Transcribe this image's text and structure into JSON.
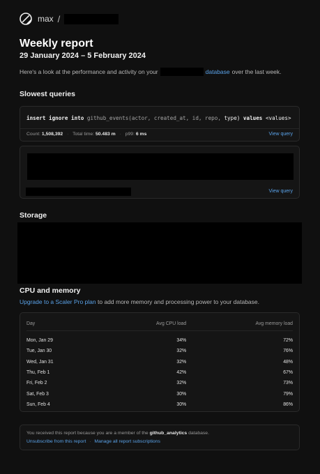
{
  "header": {
    "user": "max",
    "separator": "/"
  },
  "report": {
    "title": "Weekly report",
    "date_range": "29 January 2024 – 5 February 2024",
    "intro_before": "Here's a look at the performance and activity on your",
    "intro_link": "database",
    "intro_after": "over the last week."
  },
  "slowest_queries": {
    "heading": "Slowest queries",
    "query1": {
      "code_kw1": "insert ignore into",
      "code_table": "github_events(actor, created_at, id, repo,",
      "code_kw2": "type)",
      "code_kw3": "values",
      "code_tail": "<values>",
      "count_label": "Count:",
      "count_value": "1,508,392",
      "total_label": "Total time:",
      "total_value": "50.483 m",
      "p99_label": "p99:",
      "p99_value": "6 ms",
      "view": "View query"
    },
    "query2": {
      "view": "View query"
    }
  },
  "storage": {
    "heading": "Storage"
  },
  "cpu_memory": {
    "heading": "CPU and memory",
    "upsell_link": "Upgrade to a Scaler Pro plan",
    "upsell_text": "to add more memory and processing power to your database.",
    "columns": [
      "Day",
      "Avg CPU load",
      "Avg memory load"
    ],
    "rows": [
      {
        "day": "Mon, Jan 29",
        "cpu": "34%",
        "mem": "72%"
      },
      {
        "day": "Tue, Jan 30",
        "cpu": "32%",
        "mem": "76%"
      },
      {
        "day": "Wed, Jan 31",
        "cpu": "32%",
        "mem": "48%"
      },
      {
        "day": "Thu, Feb 1",
        "cpu": "42%",
        "mem": "67%"
      },
      {
        "day": "Fri, Feb 2",
        "cpu": "32%",
        "mem": "73%"
      },
      {
        "day": "Sat, Feb 3",
        "cpu": "30%",
        "mem": "79%"
      },
      {
        "day": "Sun, Feb 4",
        "cpu": "30%",
        "mem": "86%"
      }
    ]
  },
  "footer": {
    "text_before": "You received this report because you are a member of the",
    "db_name": "github_analytics",
    "text_after": "database.",
    "unsubscribe": "Unsubscribe from this report",
    "separator": "·",
    "manage": "Manage all report subscriptions"
  },
  "colors": {
    "background": "#101010",
    "link": "#5aa2e8",
    "card": "#151515"
  },
  "icons": {
    "logo": "planetscale-logo-icon"
  }
}
